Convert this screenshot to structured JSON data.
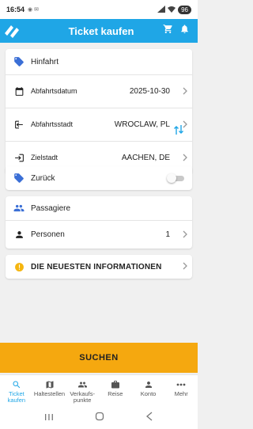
{
  "status": {
    "time": "16:54",
    "battery": "96"
  },
  "appbar": {
    "title": "Ticket kaufen"
  },
  "outbound": {
    "heading": "Hinfahrt",
    "date_label": "Abfahrtsdatum",
    "date_value": "2025-10-30",
    "origin_label": "Abfahrtsstadt",
    "origin_value": "WROCLAW, PL",
    "destination_label": "Zielstadt",
    "destination_value": "AACHEN, DE"
  },
  "return": {
    "label": "Zurück",
    "enabled": false
  },
  "passengers": {
    "heading": "Passagiere",
    "persons_label": "Personen",
    "persons_value": "1"
  },
  "info": {
    "label": "DIE NEUESTEN INFORMATIONEN"
  },
  "search": {
    "label": "SUCHEN"
  },
  "nav": {
    "items": [
      {
        "label": "Ticket kaufen",
        "icon": "search-icon",
        "active": true
      },
      {
        "label": "Haltestellen",
        "icon": "map-icon"
      },
      {
        "label": "Verkaufs-punkte",
        "icon": "people-icon"
      },
      {
        "label": "Reise",
        "icon": "briefcase-icon"
      },
      {
        "label": "Konto",
        "icon": "person-icon"
      },
      {
        "label": "Mehr",
        "icon": "more-icon"
      }
    ]
  },
  "colors": {
    "brand": "#1fa6e6",
    "accent": "#f5a80f",
    "info": "#e9a50d"
  }
}
